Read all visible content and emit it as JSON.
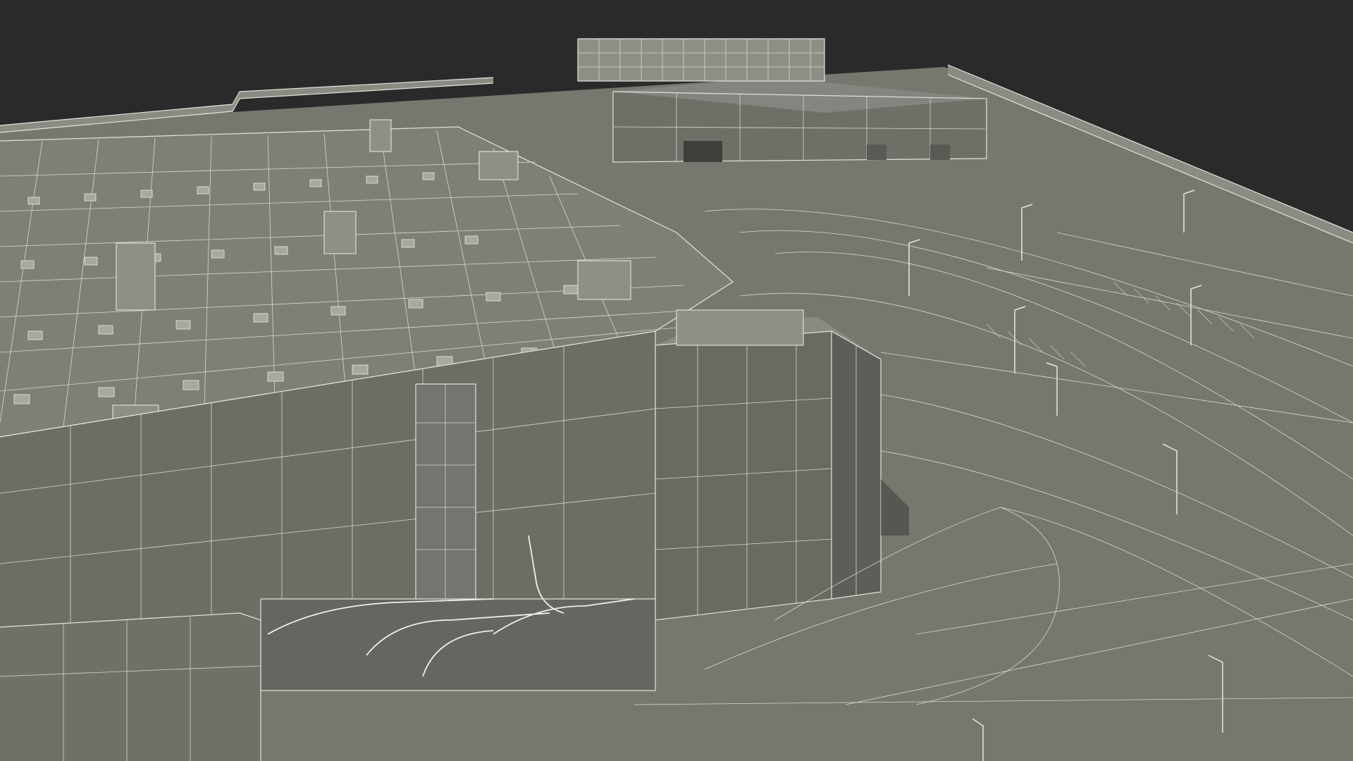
{
  "image": {
    "subject": "",
    "colors": {
      "background": "#2a2a2a",
      "ground": "#777770",
      "roof": "#807f77",
      "facade": "#6d6d66",
      "facade_dark": "#5e5e58",
      "wire": "#e4e4dc",
      "shadow": "#4a4a45"
    }
  }
}
